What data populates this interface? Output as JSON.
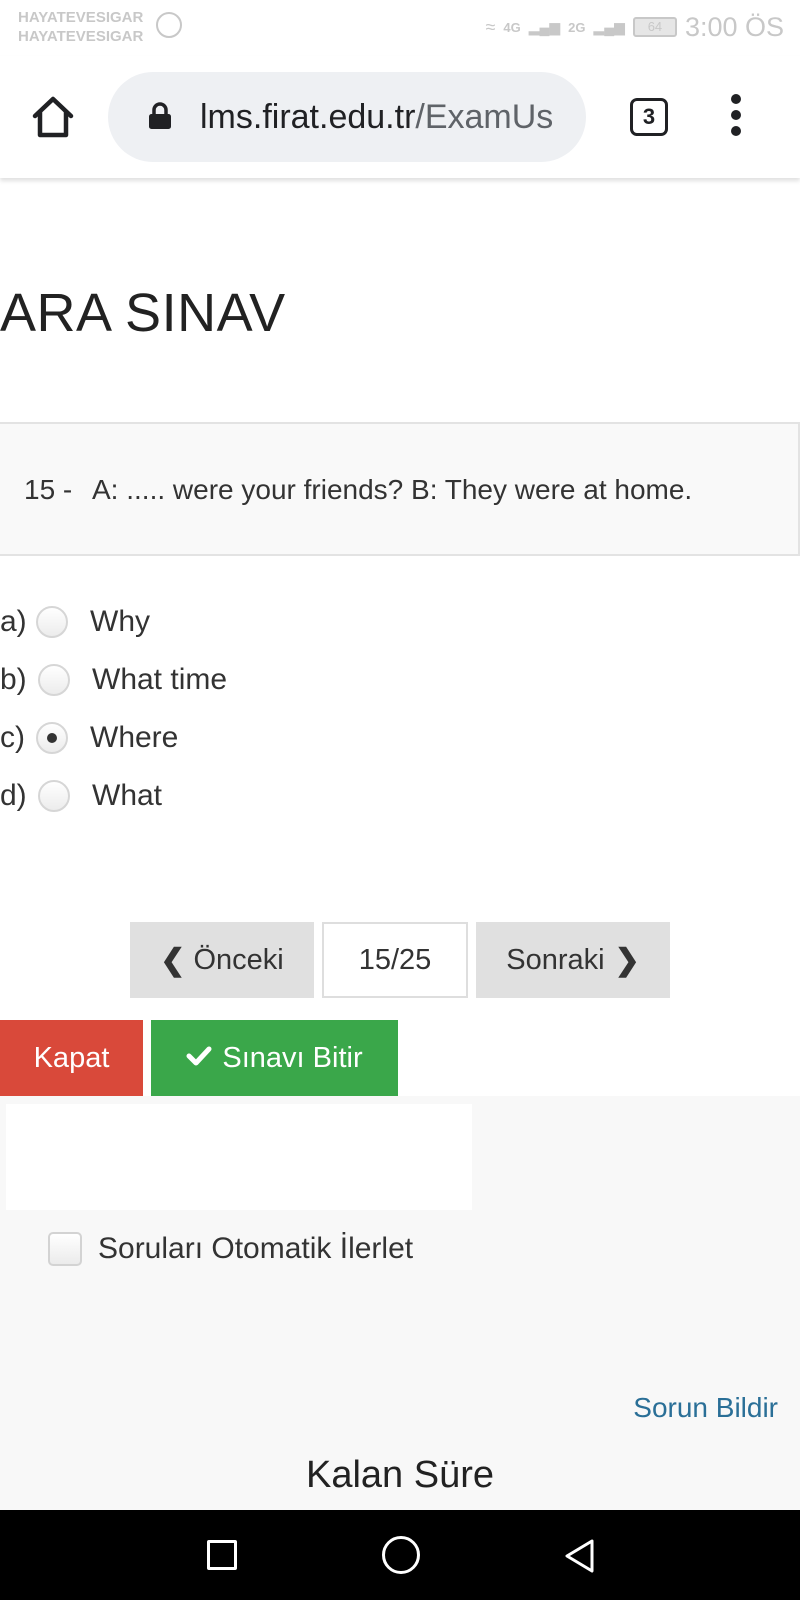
{
  "status_bar": {
    "carrier_line1": "HAYATEVESIGAR",
    "carrier_line2": "HAYATEVESIGAR",
    "signal1": "4G",
    "signal2": "2G",
    "battery": "64",
    "time": "3:00 ÖS"
  },
  "browser": {
    "url_host": "lms.firat.edu.tr",
    "url_path": "/ExamUs",
    "tab_count": "3"
  },
  "page": {
    "title": "ARA SINAV",
    "question": {
      "number": "15 -",
      "text": "A: ..... were your friends? B: They were at home."
    },
    "options": [
      {
        "letter": "a)",
        "label": "Why",
        "selected": false
      },
      {
        "letter": "b)",
        "label": "What time",
        "selected": false
      },
      {
        "letter": "c)",
        "label": "Where",
        "selected": true
      },
      {
        "letter": "d)",
        "label": "What",
        "selected": false
      }
    ],
    "nav": {
      "prev_label": "Önceki",
      "page_indicator": "15/25",
      "next_label": "Sonraki"
    },
    "close_label": "Kapat",
    "finish_label": "Sınavı Bitir",
    "auto_advance_label": "Soruları Otomatik İlerlet",
    "report_label": "Sorun Bildir",
    "remaining_time_label": "Kalan Süre"
  },
  "colors": {
    "danger": "#d9493a",
    "success": "#3aa74a",
    "link": "#2a6f97"
  }
}
